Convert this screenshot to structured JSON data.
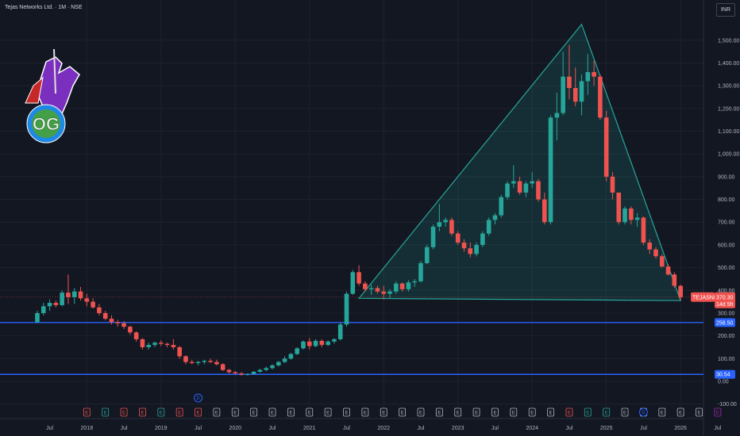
{
  "header": {
    "title": "Tejas Networks Ltd. · 1M · NSE"
  },
  "currency_button": {
    "label": "INR"
  },
  "logo": {
    "text": "OG",
    "icon": "knight-horse-logo"
  },
  "colors": {
    "background": "#131722",
    "up": "#26a69a",
    "down": "#ef5350",
    "support_line": "#2962ff",
    "triangle": "#26a69a",
    "grid": "#1e222d"
  },
  "events": [
    "E",
    "E",
    "E",
    "E",
    "E",
    "E",
    "E",
    "E",
    "E",
    "E",
    "E",
    "E",
    "E",
    "E",
    "E",
    "E",
    "E",
    "E",
    "E",
    "E",
    "E",
    "E",
    "E",
    "E",
    "E",
    "E",
    "E",
    "E",
    "E",
    "E",
    "E",
    "E",
    "E",
    "E",
    "E"
  ],
  "dividend_marks": [
    "D",
    "D"
  ],
  "chart_data": {
    "type": "candlestick",
    "title": "Tejas Networks Ltd. · 1M · NSE",
    "symbol": "TEJASNET",
    "interval": "1M",
    "y_ticks": [
      "1,500.00",
      "1,400.00",
      "1,300.00",
      "1,200.00",
      "1,100.00",
      "1,000.00",
      "900.00",
      "800.00",
      "700.00",
      "600.00",
      "500.00",
      "400.00",
      "300.00",
      "200.00",
      "100.00",
      "0.00",
      "-100.00"
    ],
    "x_labels": [
      "Jul",
      "2018",
      "Jul",
      "2019",
      "Jul",
      "2020",
      "Jul",
      "2021",
      "Jul",
      "2022",
      "Jul",
      "2023",
      "Jul",
      "2024",
      "Jul",
      "2025",
      "Jul",
      "2026",
      "Jul"
    ],
    "ylim": [
      -100,
      1560
    ],
    "grid": true,
    "last_price": {
      "symbol": "TEJASNET",
      "value": "370.30",
      "countdown": "14d 5h"
    },
    "levels": [
      {
        "value": 258.5,
        "label": "258.50"
      },
      {
        "value": 30.54,
        "label": "30.54"
      }
    ],
    "triangle": [
      {
        "x": "2021-09",
        "y": 365
      },
      {
        "x": "2024-09",
        "y": 1570
      },
      {
        "x": "2026-01",
        "y": 355
      }
    ],
    "candles": [
      [
        "2017-05",
        260,
        310,
        255,
        300
      ],
      [
        "2017-06",
        300,
        345,
        290,
        330
      ],
      [
        "2017-07",
        330,
        360,
        310,
        345
      ],
      [
        "2017-08",
        345,
        355,
        325,
        335
      ],
      [
        "2017-09",
        335,
        400,
        330,
        390
      ],
      [
        "2017-10",
        390,
        470,
        340,
        370
      ],
      [
        "2017-11",
        370,
        410,
        340,
        395
      ],
      [
        "2017-12",
        395,
        415,
        355,
        365
      ],
      [
        "2018-01",
        365,
        385,
        330,
        350
      ],
      [
        "2018-02",
        350,
        365,
        320,
        325
      ],
      [
        "2018-03",
        325,
        340,
        290,
        300
      ],
      [
        "2018-04",
        300,
        310,
        270,
        275
      ],
      [
        "2018-05",
        275,
        290,
        250,
        260
      ],
      [
        "2018-06",
        260,
        270,
        240,
        255
      ],
      [
        "2018-07",
        255,
        265,
        230,
        240
      ],
      [
        "2018-08",
        240,
        245,
        205,
        215
      ],
      [
        "2018-09",
        215,
        220,
        175,
        185
      ],
      [
        "2018-10",
        185,
        190,
        140,
        150
      ],
      [
        "2018-11",
        150,
        170,
        140,
        160
      ],
      [
        "2018-12",
        160,
        175,
        150,
        170
      ],
      [
        "2019-01",
        170,
        180,
        155,
        165
      ],
      [
        "2019-02",
        165,
        170,
        150,
        160
      ],
      [
        "2019-03",
        160,
        185,
        140,
        150
      ],
      [
        "2019-04",
        150,
        155,
        100,
        110
      ],
      [
        "2019-05",
        110,
        115,
        75,
        85
      ],
      [
        "2019-06",
        85,
        95,
        75,
        80
      ],
      [
        "2019-07",
        80,
        90,
        70,
        85
      ],
      [
        "2019-08",
        85,
        95,
        75,
        90
      ],
      [
        "2019-09",
        90,
        100,
        80,
        85
      ],
      [
        "2019-10",
        85,
        95,
        70,
        75
      ],
      [
        "2019-11",
        75,
        80,
        45,
        50
      ],
      [
        "2019-12",
        50,
        55,
        35,
        40
      ],
      [
        "2020-01",
        40,
        45,
        30,
        35
      ],
      [
        "2020-02",
        35,
        40,
        25,
        30
      ],
      [
        "2020-03",
        30,
        35,
        25,
        32
      ],
      [
        "2020-04",
        32,
        45,
        30,
        42
      ],
      [
        "2020-05",
        42,
        55,
        38,
        50
      ],
      [
        "2020-06",
        50,
        65,
        45,
        58
      ],
      [
        "2020-07",
        58,
        75,
        52,
        70
      ],
      [
        "2020-08",
        70,
        90,
        65,
        85
      ],
      [
        "2020-09",
        85,
        110,
        80,
        100
      ],
      [
        "2020-10",
        100,
        125,
        95,
        120
      ],
      [
        "2020-11",
        120,
        150,
        115,
        145
      ],
      [
        "2020-12",
        145,
        180,
        140,
        175
      ],
      [
        "2021-01",
        175,
        190,
        140,
        155
      ],
      [
        "2021-02",
        155,
        185,
        150,
        178
      ],
      [
        "2021-03",
        178,
        185,
        150,
        160
      ],
      [
        "2021-04",
        160,
        180,
        155,
        175
      ],
      [
        "2021-05",
        175,
        190,
        165,
        185
      ],
      [
        "2021-06",
        185,
        260,
        180,
        250
      ],
      [
        "2021-07",
        250,
        395,
        240,
        385
      ],
      [
        "2021-08",
        385,
        490,
        380,
        480
      ],
      [
        "2021-09",
        480,
        510,
        420,
        430
      ],
      [
        "2021-10",
        430,
        440,
        395,
        405
      ],
      [
        "2021-11",
        405,
        425,
        380,
        410
      ],
      [
        "2021-12",
        410,
        420,
        385,
        395
      ],
      [
        "2022-01",
        395,
        420,
        360,
        385
      ],
      [
        "2022-02",
        385,
        405,
        365,
        395
      ],
      [
        "2022-03",
        395,
        440,
        385,
        430
      ],
      [
        "2022-04",
        430,
        435,
        395,
        405
      ],
      [
        "2022-05",
        405,
        445,
        395,
        435
      ],
      [
        "2022-06",
        435,
        450,
        415,
        440
      ],
      [
        "2022-07",
        440,
        530,
        435,
        520
      ],
      [
        "2022-08",
        520,
        600,
        515,
        590
      ],
      [
        "2022-09",
        590,
        690,
        580,
        680
      ],
      [
        "2022-10",
        680,
        780,
        660,
        700
      ],
      [
        "2022-11",
        700,
        720,
        680,
        710
      ],
      [
        "2022-12",
        710,
        720,
        640,
        650
      ],
      [
        "2023-01",
        650,
        660,
        600,
        610
      ],
      [
        "2023-02",
        610,
        625,
        570,
        585
      ],
      [
        "2023-03",
        585,
        610,
        545,
        560
      ],
      [
        "2023-04",
        560,
        610,
        550,
        600
      ],
      [
        "2023-05",
        600,
        660,
        590,
        650
      ],
      [
        "2023-06",
        650,
        720,
        640,
        710
      ],
      [
        "2023-07",
        710,
        740,
        690,
        730
      ],
      [
        "2023-08",
        730,
        820,
        720,
        810
      ],
      [
        "2023-09",
        810,
        880,
        800,
        870
      ],
      [
        "2023-10",
        870,
        950,
        850,
        880
      ],
      [
        "2023-11",
        880,
        900,
        820,
        830
      ],
      [
        "2023-12",
        830,
        880,
        810,
        870
      ],
      [
        "2024-01",
        870,
        920,
        850,
        880
      ],
      [
        "2024-02",
        880,
        890,
        790,
        800
      ],
      [
        "2024-03",
        800,
        830,
        690,
        700
      ],
      [
        "2024-04",
        700,
        1170,
        690,
        1160
      ],
      [
        "2024-05",
        1160,
        1270,
        1060,
        1180
      ],
      [
        "2024-06",
        1180,
        1450,
        1170,
        1340
      ],
      [
        "2024-07",
        1340,
        1480,
        1240,
        1290
      ],
      [
        "2024-08",
        1290,
        1380,
        1210,
        1230
      ],
      [
        "2024-09",
        1230,
        1350,
        1170,
        1320
      ],
      [
        "2024-10",
        1320,
        1440,
        1260,
        1360
      ],
      [
        "2024-11",
        1360,
        1410,
        1300,
        1340
      ],
      [
        "2024-12",
        1340,
        1350,
        1150,
        1160
      ],
      [
        "2025-01",
        1160,
        1190,
        880,
        900
      ],
      [
        "2025-02",
        900,
        920,
        800,
        830
      ],
      [
        "2025-03",
        830,
        830,
        690,
        700
      ],
      [
        "2025-04",
        700,
        770,
        690,
        760
      ],
      [
        "2025-05",
        760,
        770,
        690,
        710
      ],
      [
        "2025-06",
        710,
        740,
        680,
        720
      ],
      [
        "2025-07",
        720,
        725,
        600,
        610
      ],
      [
        "2025-08",
        610,
        625,
        560,
        580
      ],
      [
        "2025-09",
        580,
        590,
        540,
        550
      ],
      [
        "2025-10",
        550,
        560,
        500,
        505
      ],
      [
        "2025-11",
        505,
        515,
        465,
        470
      ],
      [
        "2025-12",
        470,
        480,
        410,
        420
      ],
      [
        "2026-01",
        420,
        425,
        355,
        370
      ]
    ]
  }
}
